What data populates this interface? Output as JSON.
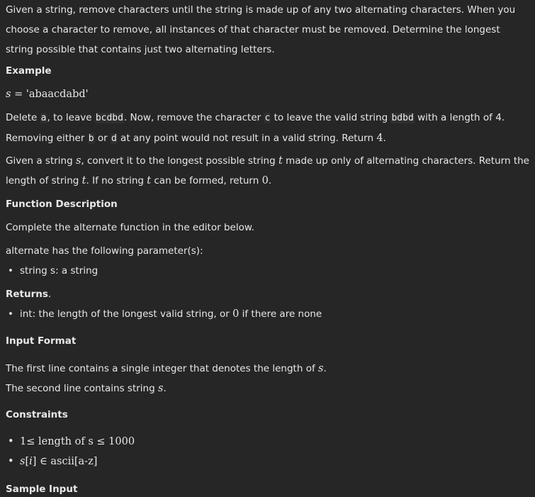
{
  "intro": "Given a string, remove characters until the string is made up of any two alternating characters. When you choose a character to remove, all instances of that character must be removed. Determine the longest string possible that contains just two alternating letters.",
  "example": {
    "heading": "Example",
    "s_var": "s",
    "s_eq": "=",
    "s_val": "'abaacdabd'",
    "text1_a": "Delete ",
    "code_a": "a",
    "text1_b": ", to leave ",
    "code_bcdbd": "bcdbd",
    "text1_c": ". Now, remove the character ",
    "code_c": "c",
    "text1_d": " to leave the valid string ",
    "code_bdbd": "bdbd",
    "text1_e": " with a length of 4. Removing either ",
    "code_b": "b",
    "text1_f": " or ",
    "code_d": "d",
    "text1_g": " at any point would not result in a valid string. Return ",
    "text1_ret": "4",
    "text1_end": "."
  },
  "given": {
    "p1": "Given a string ",
    "v_s": "s",
    "p2": ", convert it to the longest possible string ",
    "v_t": "t",
    "p3": " made up only of alternating characters. Return the length of string ",
    "v_t2": "t",
    "p4": ". If no string ",
    "v_t3": "t",
    "p5": " can be formed, return ",
    "zero": "0",
    "p6": "."
  },
  "function_description": {
    "heading": "Function Description",
    "line1": "Complete the alternate function in the editor below.",
    "line2": "alternate has the following parameter(s):",
    "params": [
      "string s: a string"
    ]
  },
  "returns": {
    "heading": "Returns",
    "item_a": "int: the length of the longest valid string, or ",
    "item_zero": "0",
    "item_b": " if there are none"
  },
  "input_format": {
    "heading": "Input Format",
    "line1_a": "The first line contains a single integer that denotes the length of ",
    "line1_s": "s",
    "line1_end": ".",
    "line2_a": "The second line contains string ",
    "line2_s": "s",
    "line2_end": "."
  },
  "constraints": {
    "heading": "Constraints",
    "c1_one": "1",
    "c1_le": "≤",
    "c1_text": "length of s",
    "c1_le2": "≤",
    "c1_max": "1000",
    "c2_s": "s",
    "c2_br1": "[",
    "c2_i": "i",
    "c2_br2": "]",
    "c2_in": "∈",
    "c2_set": "ascii[a-z]"
  },
  "sample_input": {
    "heading": "Sample Input"
  }
}
